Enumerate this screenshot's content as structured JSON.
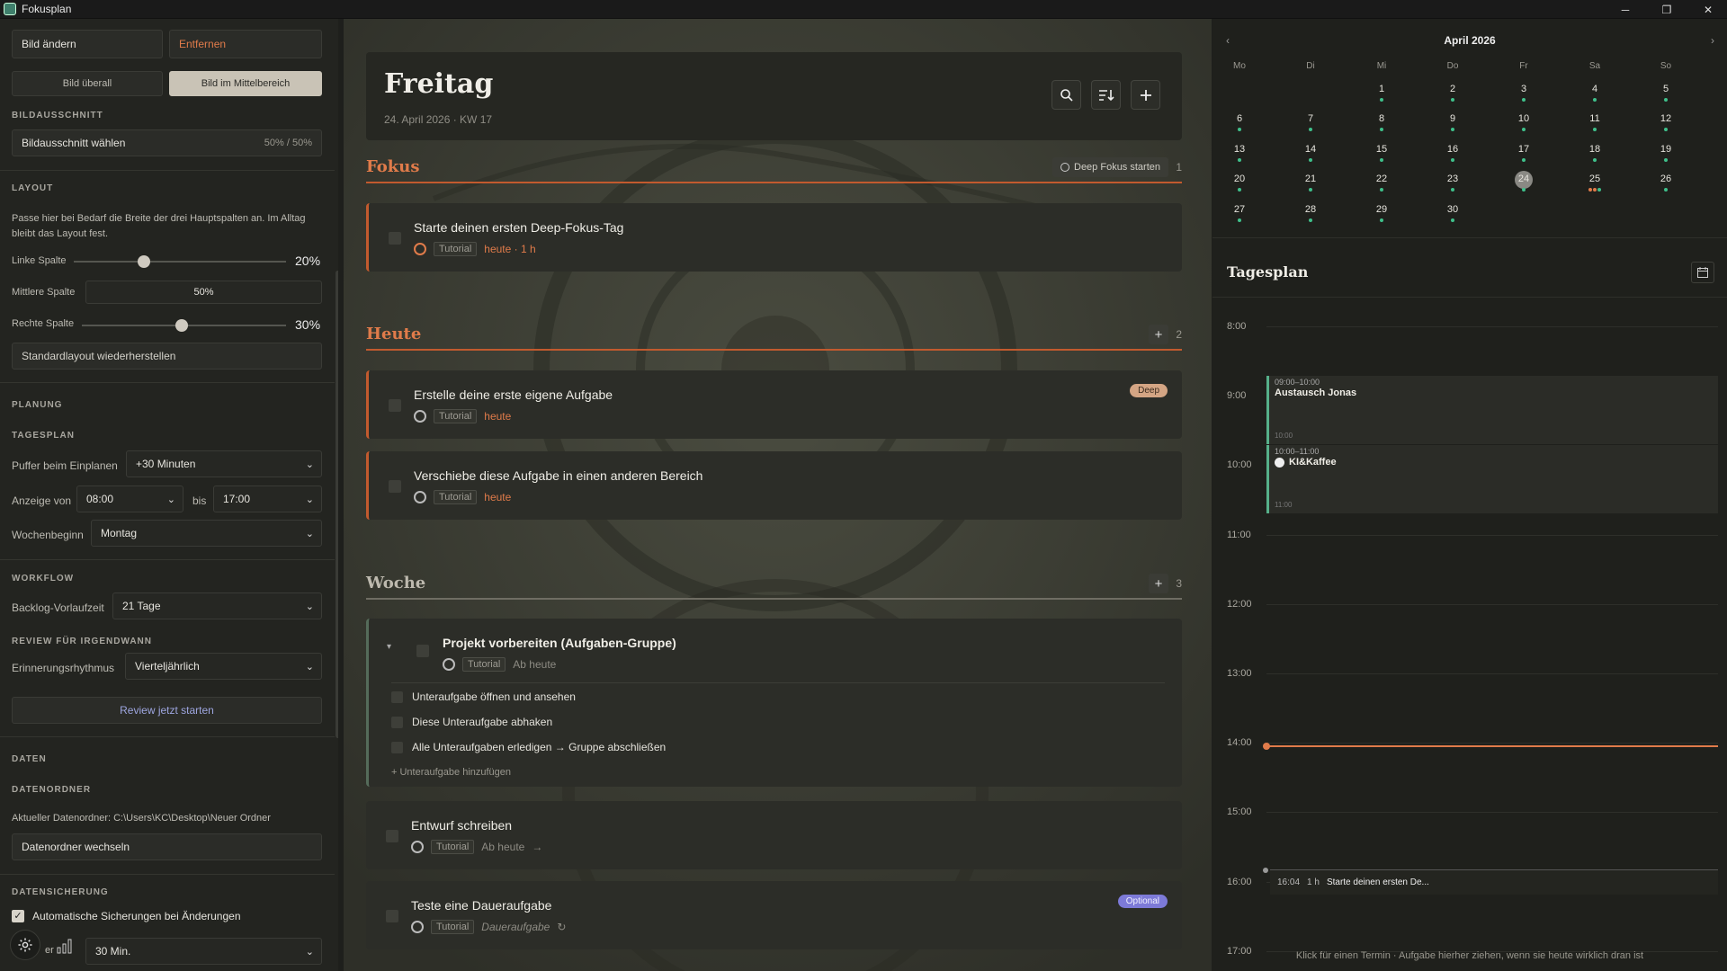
{
  "window": {
    "title": "Fokusplan",
    "minimize": "─",
    "maximize": "❐",
    "close": "✕"
  },
  "left": {
    "change_image": "Bild ändern",
    "remove": "Entfernen",
    "image_everywhere": "Bild überall",
    "image_middle": "Bild im Mittelbereich",
    "crop_label": "BILDAUSSCHNITT",
    "crop_button": "Bildausschnitt wählen",
    "crop_value": "50% / 50%",
    "layout_label": "LAYOUT",
    "layout_desc": "Passe hier bei Bedarf die Breite der drei Hauptspalten an. Im Alltag bleibt das Layout fest.",
    "left_col_label": "Linke Spalte",
    "left_col_value": "20%",
    "left_col_pct": 20,
    "mid_col_label": "Mittlere Spalte",
    "mid_col_value": "50%",
    "right_col_label": "Rechte Spalte",
    "right_col_value": "30%",
    "right_col_pct": 30,
    "reset_layout": "Standardlayout wiederherstellen",
    "planning_label": "PLANUNG",
    "dayplan_label": "TAGESPLAN",
    "buffer_label": "Puffer beim Einplanen",
    "buffer_value": "+30 Minuten",
    "display_from_label": "Anzeige von",
    "display_from": "08:00",
    "to_label": "bis",
    "display_to": "17:00",
    "week_start_label": "Wochenbeginn",
    "week_start": "Montag",
    "workflow_label": "WORKFLOW",
    "backlog_label": "Backlog-Vorlaufzeit",
    "backlog_value": "21 Tage",
    "review_label": "REVIEW FÜR IRGENDWANN",
    "reminder_label": "Erinnerungsrhythmus",
    "reminder_value": "Vierteljährlich",
    "review_now": "Review jetzt starten",
    "data_label": "DATEN",
    "datafolder_label": "DATENORDNER",
    "current_folder": "Aktueller Datenordner: C:\\Users\\KC\\Desktop\\Neuer Ordner",
    "change_folder": "Datenordner wechseln",
    "backup_label": "DATENSICHERUNG",
    "auto_backup": "Automatische Sicherungen bei Änderungen",
    "interval_prefix": "er",
    "interval_value": "30 Min."
  },
  "middle": {
    "title": "Freitag",
    "subtitle": "24. April 2026 · KW 17",
    "focus": {
      "name": "Fokus",
      "deep_button": "Deep Fokus starten",
      "count": "1"
    },
    "today": {
      "name": "Heute",
      "count": "2"
    },
    "week": {
      "name": "Woche",
      "count": "3"
    },
    "tasks": [
      {
        "title": "Starte deinen ersten Deep-Fokus-Tag",
        "tag": "Tutorial",
        "due": "heute · 1 h"
      },
      {
        "title": "Erstelle deine erste eigene Aufgabe",
        "tag": "Tutorial",
        "due": "heute",
        "badge": "Deep"
      },
      {
        "title": "Verschiebe diese Aufgabe in einen anderen Bereich",
        "tag": "Tutorial",
        "due": "heute"
      },
      {
        "title": "Projekt vorbereiten (Aufgaben-Gruppe)",
        "tag": "Tutorial",
        "due": "Ab heute"
      },
      {
        "title": "Entwurf schreiben",
        "tag": "Tutorial",
        "due": "Ab heute",
        "arrow": "→"
      },
      {
        "title": "Teste eine Daueraufgabe",
        "tag": "Tutorial",
        "due": "Daueraufgabe",
        "badge": "Optional",
        "repeat": "↻"
      }
    ],
    "subtasks": [
      "Unteraufgabe öffnen und ansehen",
      "Diese Unteraufgabe abhaken",
      "Alle Unteraufgaben erledigen → Gruppe abschließen"
    ],
    "add_subtask": "+ Unteraufgabe hinzufügen",
    "collapse": "▾"
  },
  "right": {
    "month": "April 2026",
    "prev": "‹",
    "next": "›",
    "weekdays": [
      "Mo",
      "Di",
      "Mi",
      "Do",
      "Fr",
      "Sa",
      "So"
    ],
    "today_day": "24",
    "dayplan_title": "Tagesplan",
    "hours": [
      "8:00",
      "9:00",
      "10:00",
      "11:00",
      "12:00",
      "13:00",
      "14:00",
      "15:00",
      "16:00",
      "17:00"
    ],
    "events": [
      {
        "time": "09:00–10:00",
        "name": "Austausch Jonas",
        "end": "10:00"
      },
      {
        "time": "10:00–11:00",
        "name": "KI&Kaffee",
        "end": "11:00"
      }
    ],
    "scheduled": {
      "time": "16:04",
      "dur": "1 h",
      "name": "Starte deinen ersten De..."
    },
    "hint": "Klick für einen Termin · Aufgabe hierher ziehen, wenn sie heute wirklich dran ist",
    "colors": {
      "green": "#3fbf8a",
      "orange": "#e07b4a"
    }
  }
}
